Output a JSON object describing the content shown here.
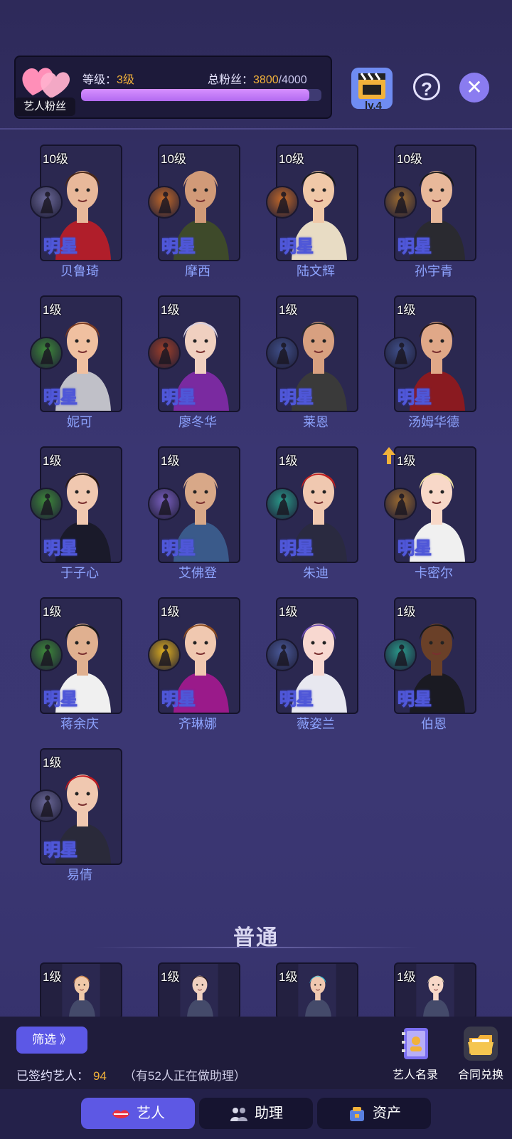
{
  "header": {
    "fan_label": "艺人粉丝",
    "level_label": "等级：",
    "level_value": "3级",
    "fans_label": "总粉丝：",
    "fans_current": "3800",
    "fans_total": "/4000",
    "progress": 0.95,
    "clapper_level": "lv.4",
    "help_symbol": "?",
    "close_symbol": "✕"
  },
  "star_label": "明星",
  "artists": [
    {
      "level": "10级",
      "name": "贝鲁琦",
      "skin": "#e8b89a",
      "hair": "#4a2818",
      "outfit": "#b01e2a",
      "badge": "#6a6898",
      "icon": "climber-icon"
    },
    {
      "level": "10级",
      "name": "摩西",
      "skin": "#d19a78",
      "hair": "#d19a78",
      "outfit": "#3e4a2a",
      "badge": "#c46a2a",
      "icon": "thinker-icon"
    },
    {
      "level": "10级",
      "name": "陆文辉",
      "skin": "#f0c8a8",
      "hair": "#1a1a1a",
      "outfit": "#e8dcc4",
      "badge": "#c46a2a",
      "icon": "thinker-icon"
    },
    {
      "level": "10级",
      "name": "孙宇青",
      "skin": "#e8b89a",
      "hair": "#1a1a1a",
      "outfit": "#2a2a30",
      "badge": "#9a6a30",
      "icon": "parachute-icon"
    },
    {
      "level": "1级",
      "name": "妮可",
      "skin": "#f0c0a0",
      "hair": "#7a3a20",
      "outfit": "#c0c0c8",
      "badge": "#3e8a3a",
      "icon": "liberty-icon"
    },
    {
      "level": "1级",
      "name": "廖冬华",
      "skin": "#f0d0c0",
      "hair": "#d8d0e0",
      "outfit": "#7a2aa0",
      "badge": "#a0402a",
      "icon": "tree-icon"
    },
    {
      "level": "1级",
      "name": "莱恩",
      "skin": "#d8a080",
      "hair": "#2a2a2a",
      "outfit": "#3a3a3a",
      "badge": "#40508a",
      "icon": "ship-icon"
    },
    {
      "level": "1级",
      "name": "汤姆华德",
      "skin": "#e0a888",
      "hair": "#2a1a18",
      "outfit": "#8a1a20",
      "badge": "#40508a",
      "icon": "ship-icon"
    },
    {
      "level": "1级",
      "name": "于子心",
      "skin": "#f0c8b0",
      "hair": "#2a1810",
      "outfit": "#1a1a2a",
      "badge": "#3e8a3a",
      "icon": "liberty-icon"
    },
    {
      "level": "1级",
      "name": "艾佛登",
      "skin": "#d8a888",
      "hair": "#d8a888",
      "outfit": "#3a5a8a",
      "badge": "#7a60c0",
      "icon": "spiral-icon"
    },
    {
      "level": "1级",
      "name": "朱迪",
      "skin": "#f0c8b0",
      "hair": "#c02020",
      "outfit": "#2a2a40",
      "badge": "#2a9a8a",
      "icon": "dancer-icon"
    },
    {
      "level": "1级",
      "name": "卡密尔",
      "skin": "#f8d8c8",
      "hair": "#f0e0a0",
      "outfit": "#f0f0f0",
      "badge": "#9a6a30",
      "icon": "parachute-icon"
    },
    {
      "level": "1级",
      "name": "蒋余庆",
      "skin": "#e0b090",
      "hair": "#1a1a1a",
      "outfit": "#f0f0f0",
      "badge": "#3e8a3a",
      "icon": "liberty-icon"
    },
    {
      "level": "1级",
      "name": "齐琳娜",
      "skin": "#f0c8b0",
      "hair": "#8a4a20",
      "outfit": "#9a1a8a",
      "badge": "#e0b020",
      "icon": "soldier-icon"
    },
    {
      "level": "1级",
      "name": "薇姿兰",
      "skin": "#f8d8d0",
      "hair": "#6a4ab0",
      "outfit": "#e8e8f0",
      "badge": "#4a5a9a",
      "icon": "ufo-icon"
    },
    {
      "level": "1级",
      "name": "伯恩",
      "skin": "#6a4028",
      "hair": "#1a1a1a",
      "outfit": "#1a1a22",
      "badge": "#2a9a8a",
      "icon": "dancer-icon"
    },
    {
      "level": "1级",
      "name": "易倩",
      "skin": "#f0c8b0",
      "hair": "#c01a20",
      "outfit": "#2a2a3a",
      "badge": "#6a6898",
      "icon": "climber-icon"
    }
  ],
  "common_section": {
    "title": "普通",
    "artists": [
      {
        "level": "1级",
        "skin": "#f0c8a8",
        "hair": "#c07030"
      },
      {
        "level": "1级",
        "skin": "#f0d0c0",
        "hair": "#2a1a18"
      },
      {
        "level": "1级",
        "skin": "#f0c8b0",
        "hair": "#30c0d8"
      },
      {
        "level": "1级",
        "skin": "#f8d8c8",
        "hair": "#f0e0b0"
      }
    ]
  },
  "bottom": {
    "filter_label": "筛选 》",
    "signed_label": "已签约艺人：",
    "signed_count": "94",
    "assistant_note": "（有52人正在做助理）",
    "roster_label": "艺人名录",
    "contract_label": "合同兑换"
  },
  "tabs": [
    {
      "label": "艺人",
      "active": true
    },
    {
      "label": "助理",
      "active": false
    },
    {
      "label": "资产",
      "active": false
    }
  ],
  "colors": {
    "accent": "#5d58e4",
    "gold": "#f2b23a",
    "name_blue": "#8ea4ff",
    "progress": "#c27af5"
  }
}
